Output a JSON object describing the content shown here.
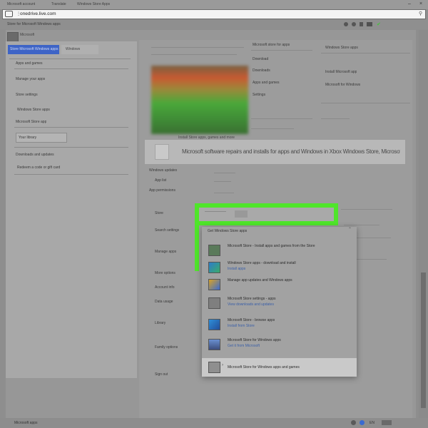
{
  "browser": {
    "tabs": [
      "Microsoft account",
      "Translate",
      "Windows Store Apps"
    ],
    "url": "onedrive.live.com",
    "bookmarks_text": "Store for Microsoft Windows apps"
  },
  "sidebar": {
    "header": "Microsoft",
    "tabs": [
      "Store Microsoft Windows apps",
      "Windows"
    ],
    "items": [
      "Apps and games",
      "Manage your apps",
      "Store settings",
      "Windows Store apps",
      "Microsoft Store app",
      "Your library",
      "Downloads and updates",
      "Redeem a code or gift card"
    ]
  },
  "main": {
    "section_title": "Microsoft store for apps",
    "install_text": "Install Store apps, games and more",
    "headline": "Microsoft software repairs and installs for apps and Windows in Xbox Windows Store, Microsoft settings, Store apps",
    "panel_items": [
      "Download",
      "Downloads",
      "Apps and games",
      "Settings"
    ],
    "row_items": [
      "Windows updates",
      "App list",
      "App permissions",
      "Store",
      "Search settings",
      "Manage apps",
      "More options",
      "Account info",
      "Data usage",
      "Library",
      "Family options",
      "Sign out"
    ],
    "right_list": [
      "Windows Store apps",
      "Install Microsoft app",
      "Microsoft for Windows"
    ]
  },
  "menu": {
    "header": "Get Windows Store apps",
    "items": [
      {
        "title": "Microsoft Store - Install apps and games from the Store",
        "link": ""
      },
      {
        "title": "Windows Store apps - download and install",
        "link": "Install apps"
      },
      {
        "title": "Manage app updates and Windows apps",
        "link": ""
      },
      {
        "title": "Microsoft Store settings - apps",
        "link": "View downloads and updates"
      },
      {
        "title": "Microsoft Store - browse apps",
        "link": "Install from Store"
      },
      {
        "title": "Microsoft Store for Windows apps",
        "link": "Get it from Microsoft"
      },
      {
        "title": "Microsoft Store for Windows apps and games",
        "link": ""
      }
    ]
  },
  "status": {
    "left": "Microsoft apps",
    "right": "EN"
  },
  "colors": {
    "highlight": "#4fe52a",
    "link": "#3a5fa8",
    "selected_tab": "#3e64c6"
  }
}
